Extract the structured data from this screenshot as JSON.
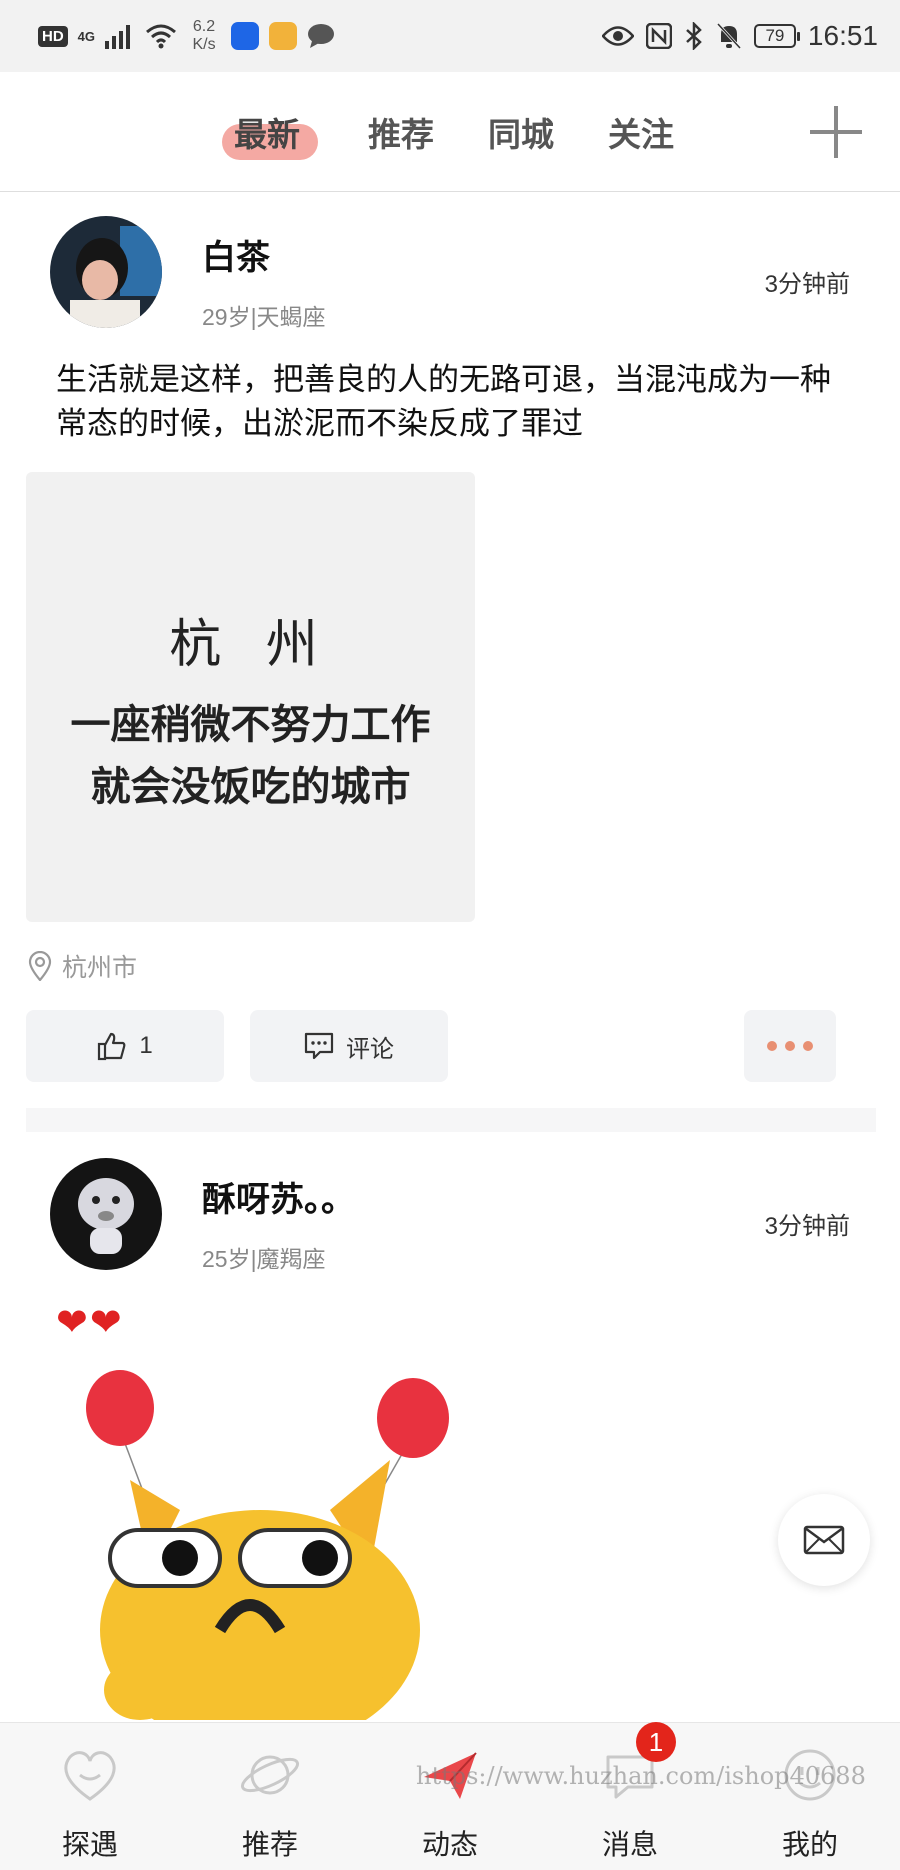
{
  "status_bar": {
    "left_badges": [
      "HD",
      "4G"
    ],
    "net_speed": "6.2",
    "net_unit": "K/s",
    "battery": "79",
    "time": "16:51"
  },
  "top_tabs": [
    "最新",
    "推荐",
    "同城",
    "关注"
  ],
  "active_tab": "最新",
  "posts": [
    {
      "author": "白茶",
      "meta": "29岁|天蝎座",
      "time": "3分钟前",
      "text": "生活就是这样，把善良的人的无路可退，当混沌成为一种常态的时候，出淤泥而不染反成了罪过",
      "image_text": {
        "title": "杭 州",
        "line1": "一座稍微不努力工作",
        "line2": "就会没饭吃的城市"
      },
      "location": "杭州市",
      "like_count": "1",
      "comment_label": "评论"
    },
    {
      "author": "酥呀苏。。",
      "meta": "25岁|魔羯座",
      "time": "3分钟前",
      "text": "❤❤"
    }
  ],
  "bottom_nav": [
    {
      "label": "探遇",
      "icon": "heart-face-icon"
    },
    {
      "label": "推荐",
      "icon": "planet-icon"
    },
    {
      "label": "动态",
      "icon": "paper-plane-icon"
    },
    {
      "label": "消息",
      "icon": "message-icon"
    },
    {
      "label": "我的",
      "icon": "smile-face-icon"
    }
  ],
  "message_badge": "1",
  "watermark": "https://www.huzhan.com/ishop40688",
  "colors": {
    "accent": "#e88f72",
    "tab_highlight": "#f4a9a3",
    "active_nav": "#e9474a",
    "badge": "#e3251b"
  }
}
